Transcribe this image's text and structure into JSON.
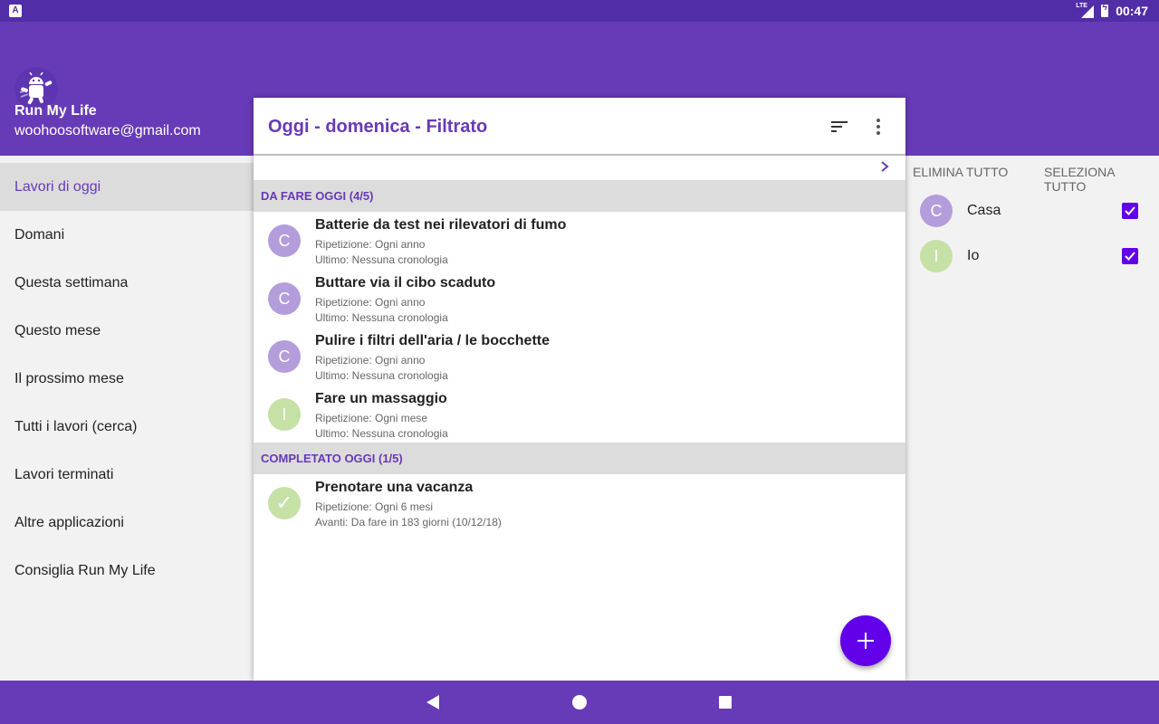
{
  "status_bar": {
    "network": "LTE",
    "time": "00:47"
  },
  "drawer": {
    "app_name": "Run My Life",
    "email": "woohoosoftware@gmail.com",
    "items": [
      {
        "label": "Lavori di oggi",
        "active": true
      },
      {
        "label": "Domani"
      },
      {
        "label": "Questa settimana"
      },
      {
        "label": "Questo mese"
      },
      {
        "label": "Il prossimo mese"
      },
      {
        "label": "Tutti i lavori (cerca)"
      },
      {
        "label": "Lavori terminati"
      },
      {
        "label": "Altre applicazioni"
      },
      {
        "label": "Consiglia Run My Life"
      }
    ]
  },
  "toolbar": {
    "title": "Oggi - domenica - Filtrato",
    "sort_icon": "sort-icon",
    "more_icon": "more-vert-icon"
  },
  "sections": {
    "todo": "DA FARE OGGI (4/5)",
    "done": "COMPLETATO OGGI (1/5)"
  },
  "tasks_todo": [
    {
      "initial": "C",
      "title": "Batterie da test nei rilevatori di fumo",
      "repeat": "Ripetizione: Ogni anno",
      "last": "Ultimo: Nessuna cronologia",
      "color": "#b39ddb"
    },
    {
      "initial": "C",
      "title": "Buttare via il cibo scaduto",
      "repeat": "Ripetizione: Ogni anno",
      "last": "Ultimo: Nessuna cronologia",
      "color": "#b39ddb"
    },
    {
      "initial": "C",
      "title": "Pulire i filtri dell'aria / le bocchette",
      "repeat": "Ripetizione: Ogni anno",
      "last": "Ultimo: Nessuna cronologia",
      "color": "#b39ddb"
    },
    {
      "initial": "I",
      "title": "Fare un massaggio",
      "repeat": "Ripetizione: Ogni mese",
      "last": "Ultimo: Nessuna cronologia",
      "color": "#c5e1a5"
    }
  ],
  "tasks_done": [
    {
      "initial": "✓",
      "title": "Prenotare una vacanza",
      "repeat": "Ripetizione: Ogni 6 mesi",
      "last": "Avanti: Da fare in 183 giorni (10/12/18)",
      "color": "#c5e1a5"
    }
  ],
  "filter": {
    "delete_all": "ELIMINA TUTTO",
    "select_all": "SELEZIONA TUTTO",
    "categories": [
      {
        "initial": "C",
        "name": "Casa",
        "checked": true,
        "color": "#b39ddb"
      },
      {
        "initial": "I",
        "name": "Io",
        "checked": true,
        "color": "#c5e1a5"
      }
    ]
  },
  "colors": {
    "primary": "#673ab7",
    "primary_dark": "#512da8",
    "accent": "#6200ea"
  }
}
